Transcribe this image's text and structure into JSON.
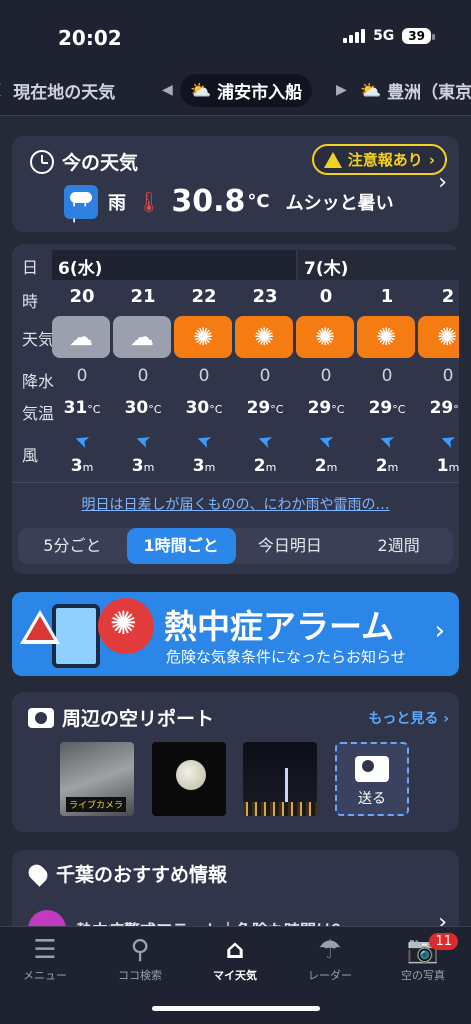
{
  "status": {
    "time": "20:02",
    "network": "5G",
    "battery": "39"
  },
  "locations": {
    "left": "現在地の天気",
    "active": "浦安市入船",
    "right": "豊洲（東京"
  },
  "now": {
    "title": "今の天気",
    "warning": "注意報あり",
    "condition": "雨",
    "temperature": "30.8",
    "unit": "°C",
    "feel": "ムシッと暑い"
  },
  "hourly": {
    "labels": {
      "day": "日",
      "hour": "時",
      "weather": "天気",
      "precip": "降水",
      "temp": "気温",
      "wind": "風"
    },
    "date_a": "6(水)",
    "date_b": "7(木)",
    "hours": [
      {
        "hour": "20",
        "weather": "cloudy",
        "precip": "0",
        "temp": "31",
        "wind": "3"
      },
      {
        "hour": "21",
        "weather": "cloudy",
        "precip": "0",
        "temp": "30",
        "wind": "3"
      },
      {
        "hour": "22",
        "weather": "sunny",
        "precip": "0",
        "temp": "30",
        "wind": "3"
      },
      {
        "hour": "23",
        "weather": "sunny",
        "precip": "0",
        "temp": "29",
        "wind": "2"
      },
      {
        "hour": "0",
        "weather": "sunny",
        "precip": "0",
        "temp": "29",
        "wind": "2"
      },
      {
        "hour": "1",
        "weather": "sunny",
        "precip": "0",
        "temp": "29",
        "wind": "2"
      },
      {
        "hour": "2",
        "weather": "sunny",
        "precip": "0",
        "temp": "29",
        "wind": "1"
      }
    ],
    "temp_unit": "°C",
    "wind_unit": "m",
    "summary": "明日は日差しが届くものの、にわか雨や雷雨の…",
    "segments": [
      "5分ごと",
      "1時間ごと",
      "今日明日",
      "2週間"
    ],
    "active_segment": "1時間ごと"
  },
  "alarm": {
    "title": "熱中症アラーム",
    "subtitle": "危険な気象条件になったらお知らせ"
  },
  "sky": {
    "title": "周辺の空リポート",
    "more": "もっと見る",
    "live_label": "ライブカメラ",
    "post_label": "送る"
  },
  "chiba": {
    "title": "千葉のおすすめ情報",
    "item": "熱中症警戒アラート｜危険な時間は？"
  },
  "nav": {
    "menu": "メニュー",
    "search": "ココ検索",
    "my": "マイ天気",
    "radar": "レーダー",
    "photo": "空の写真",
    "photo_badge": "11"
  },
  "colors": {
    "accent": "#2c86e8",
    "sunny": "#f57c12",
    "cloudy": "#9aa0ad",
    "warning": "#f2d024",
    "badge": "#e02a2a"
  }
}
